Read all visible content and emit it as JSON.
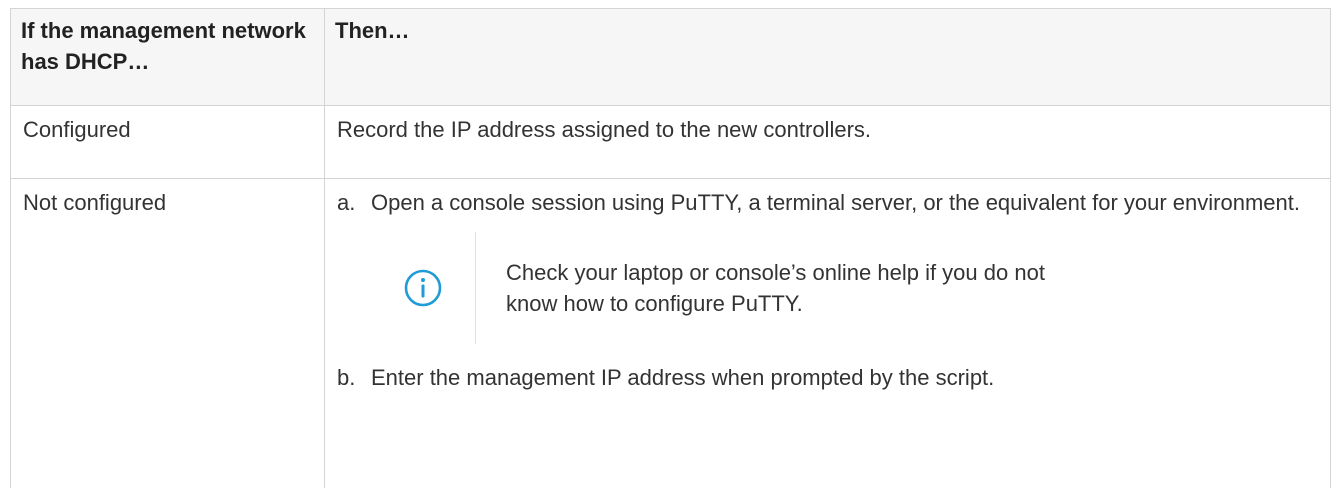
{
  "table": {
    "headers": [
      "If the management network has DHCP…",
      "Then…"
    ],
    "rows": [
      {
        "condition": "Configured",
        "action": "Record the IP address assigned to the new controllers."
      },
      {
        "condition": "Not configured",
        "steps": [
          {
            "marker": "a.",
            "text": "Open a console session using PuTTY, a terminal server, or the equivalent for your environment."
          },
          {
            "marker": "b.",
            "text": "Enter the management IP address when prompted by the script."
          }
        ],
        "note": {
          "icon": "info-icon",
          "text": "Check your laptop or console’s online help if you do not know how to configure PuTTY."
        }
      }
    ]
  },
  "colors": {
    "border": "#d4d4d4",
    "header_bg": "#f6f6f6",
    "icon": "#1f9bd7",
    "text": "#333333"
  }
}
